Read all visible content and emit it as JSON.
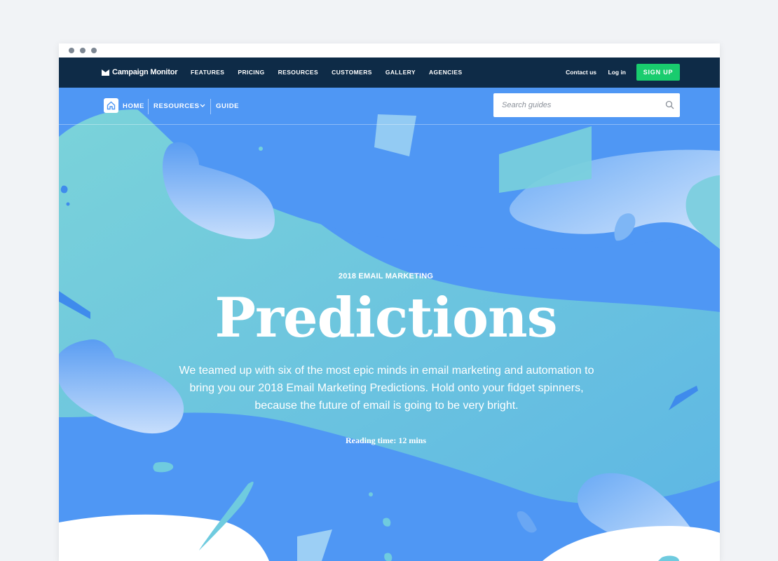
{
  "nav": {
    "logo_text": "Campaign Monitor",
    "links": [
      "FEATURES",
      "PRICING",
      "RESOURCES",
      "CUSTOMERS",
      "GALLERY",
      "AGENCIES"
    ],
    "contact_label": "Contact us",
    "login_label": "Log in",
    "signup_label": "SIGN UP"
  },
  "breadcrumb": {
    "home_label": "HOME",
    "resources_label": "RESOURCES",
    "guide_label": "GUIDE"
  },
  "search": {
    "placeholder": "Search guides",
    "value": ""
  },
  "hero": {
    "eyebrow": "2018 EMAIL MARKETING",
    "title": "Predictions",
    "intro": "We teamed up with six of the most epic minds in email marketing and automation to bring you our 2018 Email Marketing Predictions. Hold onto your fidget spinners, because the future of email is going to be very bright.",
    "reading_time": "Reading time: 12 mins"
  },
  "colors": {
    "nav_bg": "#0e2b47",
    "hero_blue": "#4f97f4",
    "teal": "#73d1dc",
    "signup_green": "#19cc6e"
  }
}
